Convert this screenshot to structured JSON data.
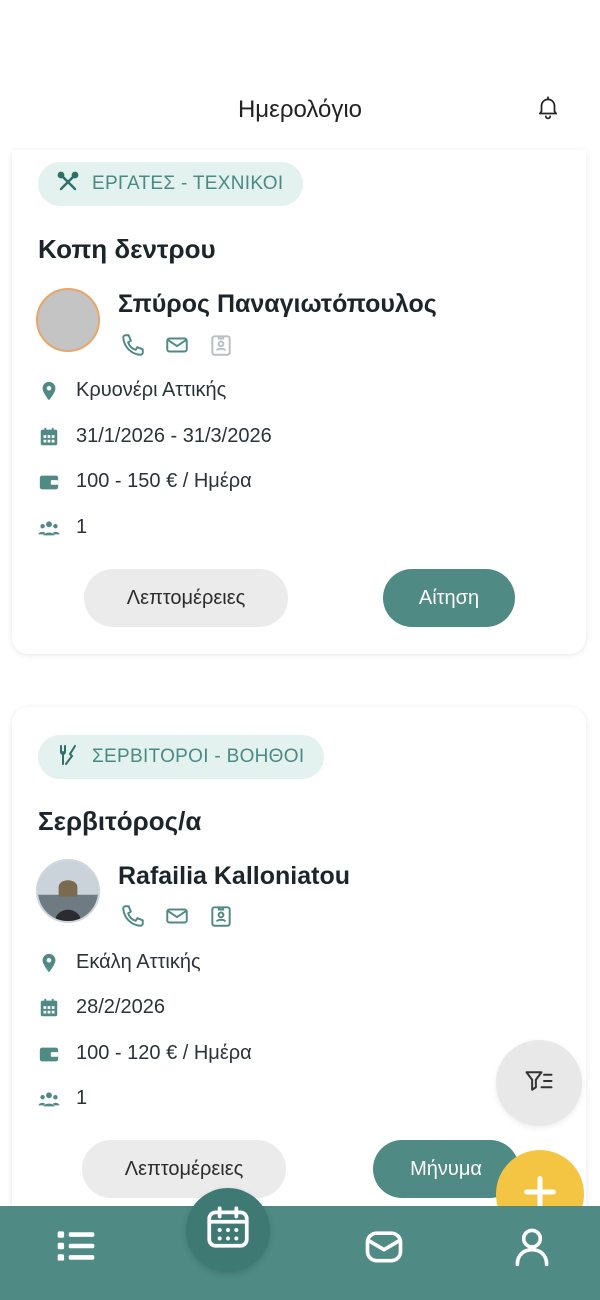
{
  "header": {
    "title": "Ημερολόγιο",
    "bell_icon": "bell-icon"
  },
  "colors": {
    "accent": "#4f8a84",
    "chip_bg": "#e3f1ef",
    "fab_yellow": "#f4c542"
  },
  "jobs": [
    {
      "category": "ΕΡΓΑΤΕΣ - ΤΕΧΝΙΚΟΙ",
      "category_icon": "tools-icon",
      "title": "Κοπη δεντρου",
      "employer": "Σπύρος Παναγιωτόπουλος",
      "location": "Κρυονέρι Αττικής",
      "dates": "31/1/2026 - 31/3/2026",
      "pay": "100 - 150 € / Ημέρα",
      "people": "1",
      "details_label": "Λεπτομέρειες",
      "action_label": "Αίτηση"
    },
    {
      "category": "ΣΕΡΒΙΤΟΡΟΙ - ΒΟΗΘΟΙ",
      "category_icon": "cutlery-icon",
      "title": "Σερβιτόρος/α",
      "employer": "Rafailia Kalloniatou",
      "location": "Εκάλη Αττικής",
      "dates": "28/2/2026",
      "pay": "100 - 120 € / Ημέρα",
      "people": "1",
      "details_label": "Λεπτομέρειες",
      "action_label": "Μήνυμα"
    }
  ],
  "bottom_nav": [
    "list-icon",
    "calendar-icon",
    "mail-icon",
    "user-icon"
  ]
}
